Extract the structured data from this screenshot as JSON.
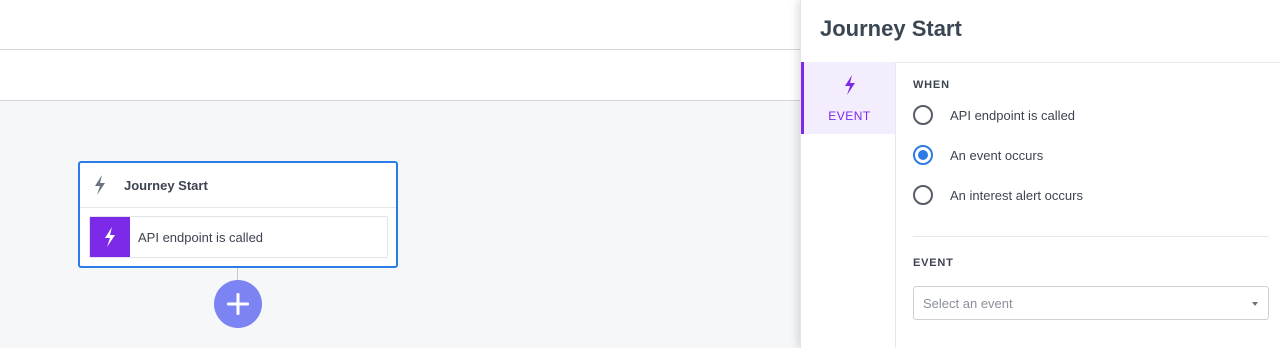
{
  "canvas": {
    "node": {
      "title": "Journey Start",
      "trigger_label": "API endpoint is called"
    }
  },
  "panel": {
    "title": "Journey Start",
    "side_tab": {
      "label": "EVENT"
    },
    "when_label": "WHEN",
    "options": [
      {
        "label": "API endpoint is called",
        "selected": false
      },
      {
        "label": "An event occurs",
        "selected": true
      },
      {
        "label": "An interest alert occurs",
        "selected": false
      }
    ],
    "event_label": "EVENT",
    "event_select": {
      "placeholder": "Select an event"
    }
  },
  "colors": {
    "accent_purple": "#7d2ae8",
    "accent_blue": "#2d7be5",
    "add_button": "#7c83f2"
  },
  "icons": {
    "node_header": "lightning-icon",
    "trigger_tile": "lightning-icon",
    "side_tab": "lightning-icon",
    "add_button": "plus-icon",
    "select_caret": "caret-down-icon"
  }
}
